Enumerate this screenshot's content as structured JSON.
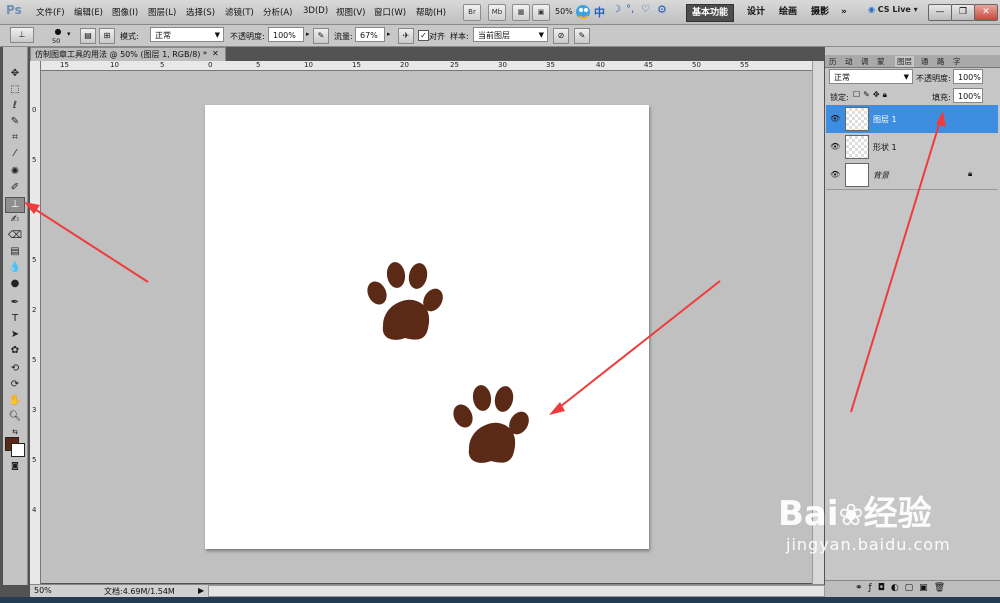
{
  "app": {
    "logo": "Ps"
  },
  "menus": [
    "文件(F)",
    "编辑(E)",
    "图像(I)",
    "图层(L)",
    "选择(S)",
    "滤镜(T)",
    "分析(A)",
    "3D(D)",
    "视图(V)",
    "窗口(W)",
    "帮助(H)"
  ],
  "menubar_buttons": [
    "Br",
    "Mb"
  ],
  "zoom_readout": "50%",
  "ime_label": "中",
  "workspaces": {
    "basic": "基本功能",
    "design": "设计",
    "paint": "绘画",
    "photo": "摄影",
    "more": "»"
  },
  "cs_live": "CS Live",
  "window_controls": [
    "—",
    "❐",
    "✕"
  ],
  "options": {
    "brush_size": "50",
    "mode_label": "模式:",
    "mode_value": "正常",
    "opacity_label": "不透明度:",
    "opacity_value": "100%",
    "flow_label": "流量:",
    "flow_value": "67%",
    "align_label": "对齐",
    "sample_label": "样本:",
    "sample_value": "当前图层"
  },
  "document": {
    "tab_title": "仿制图章工具的用法 @ 50% (图层 1, RGB/8) *",
    "close": "✕",
    "ruler_top": [
      "15",
      "10",
      "5",
      "0",
      "5",
      "10",
      "15",
      "20",
      "25",
      "30",
      "35",
      "40",
      "45",
      "50",
      "55"
    ],
    "ruler_left": [
      "0",
      "5",
      "1",
      "5",
      "2",
      "5",
      "3",
      "5",
      "4"
    ],
    "status_zoom": "50%",
    "status_doc": "文档:4.69M/1.54M"
  },
  "panel": {
    "tabs": [
      "历",
      "动",
      "调",
      "蒙",
      "图层",
      "通",
      "路",
      "字"
    ],
    "blend_mode": "正常",
    "opacity_label": "不透明度:",
    "opacity_value": "100%",
    "lock_label": "锁定:",
    "fill_label": "填充:",
    "fill_value": "100%",
    "layers": [
      {
        "name": "图层 1"
      },
      {
        "name": "形状 1"
      },
      {
        "name": "背景"
      }
    ]
  },
  "tools": [
    "move",
    "marquee",
    "lasso",
    "quick-select",
    "crop",
    "eyedropper",
    "spot-heal",
    "brush",
    "clone-stamp",
    "history-brush",
    "eraser",
    "gradient",
    "blur",
    "dodge",
    "pen",
    "type",
    "path-select",
    "shape",
    "3d-rotate",
    "3d-orbit",
    "hand",
    "zoom"
  ],
  "colors": {
    "paw": "#5a2a17",
    "arrow": "#ef3b3b",
    "selected_layer": "#3d8ee0",
    "foreground": "#5a2a17"
  },
  "watermark": {
    "brand_left": "Bai",
    "brand_right": "经验",
    "url": "jingyan.baidu.com"
  }
}
